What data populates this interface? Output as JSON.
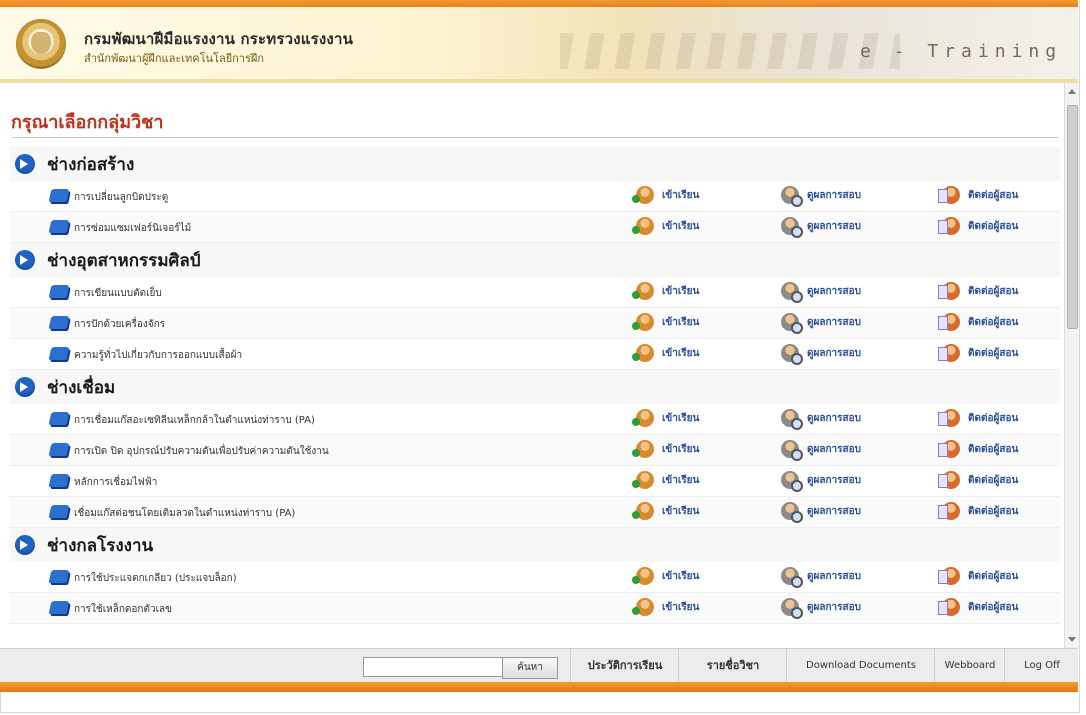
{
  "header": {
    "org_title": "กรมพัฒนาฝีมือแรงงาน กระทรวงแรงงาน",
    "org_subtitle": "สำนักพัฒนาผู้ฝึกและเทคโนโลยีการฝึก",
    "banner_text": "e - Training"
  },
  "page": {
    "title": "กรุณาเลือกกลุ่มวิชา"
  },
  "actions": {
    "enter": "เข้าเรียน",
    "score": "ดูผลการสอบ",
    "contact": "ติดต่อผู้สอน"
  },
  "categories": [
    {
      "title": "ช่างก่อสร้าง",
      "courses": [
        "การเปลี่ยนลูกบิดประตู",
        "การซ่อมแซมเฟอร์นิเจอร์ไม้"
      ]
    },
    {
      "title": "ช่างอุตสาหกรรมศิลป์",
      "courses": [
        "การเขียนแบบตัดเย็บ",
        "การปักด้วยเครื่องจักร",
        "ความรู้ทั่วไปเกี่ยวกับการออกแบบเสื้อผ้า"
      ]
    },
    {
      "title": "ช่างเชื่อม",
      "courses": [
        "การเชื่อมแก๊สอะเซทิลีนเหล็กกล้าในตำแหน่งท่าราบ (PA)",
        "การเปิด ปิด อุปกรณ์ปรับความดันเพื่อปรับค่าความดันใช้งาน",
        "หลักการเชื่อมไฟฟ้า",
        "เชื่อมแก๊สต่อชนโดยเติมลวดในตำแหน่งท่าราบ (PA)"
      ]
    },
    {
      "title": "ช่างกลโรงงาน",
      "courses": [
        "การใช้ประแจตกเกลียว (ประแจบล็อก)",
        "การใช้เหล็กตอกตัวเลข"
      ]
    }
  ],
  "footer": {
    "search_placeholder": "",
    "search_button": "ค้นหา",
    "nav": [
      "ประวัติการเรียน",
      "รายชื่อวิชา",
      "Download Documents",
      "Webboard",
      "Log Off"
    ]
  }
}
